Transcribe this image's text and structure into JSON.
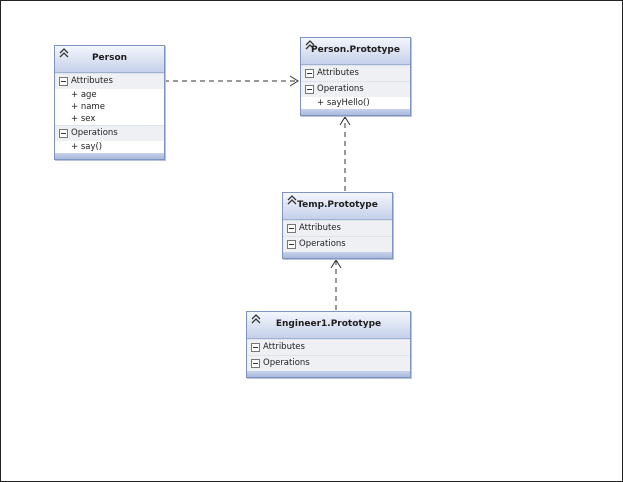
{
  "classes": {
    "person": {
      "title": "Person",
      "attributes_label": "Attributes",
      "attributes": [
        "+ age",
        "+ name",
        "+ sex"
      ],
      "operations_label": "Operations",
      "operations": [
        "+ say()"
      ]
    },
    "person_prototype": {
      "title": "Person.Prototype",
      "attributes_label": "Attributes",
      "operations_label": "Operations",
      "operations": [
        "+ sayHello()"
      ]
    },
    "temp_prototype": {
      "title": "Temp.Prototype",
      "attributes_label": "Attributes",
      "operations_label": "Operations"
    },
    "engineer_prototype": {
      "title": "Engineer1.Prototype",
      "attributes_label": "Attributes",
      "operations_label": "Operations"
    }
  },
  "colors": {
    "header_top": "#f3f6fc",
    "header_bottom": "#c5d1ea",
    "border": "#7f95c0",
    "connector": "#333333"
  }
}
